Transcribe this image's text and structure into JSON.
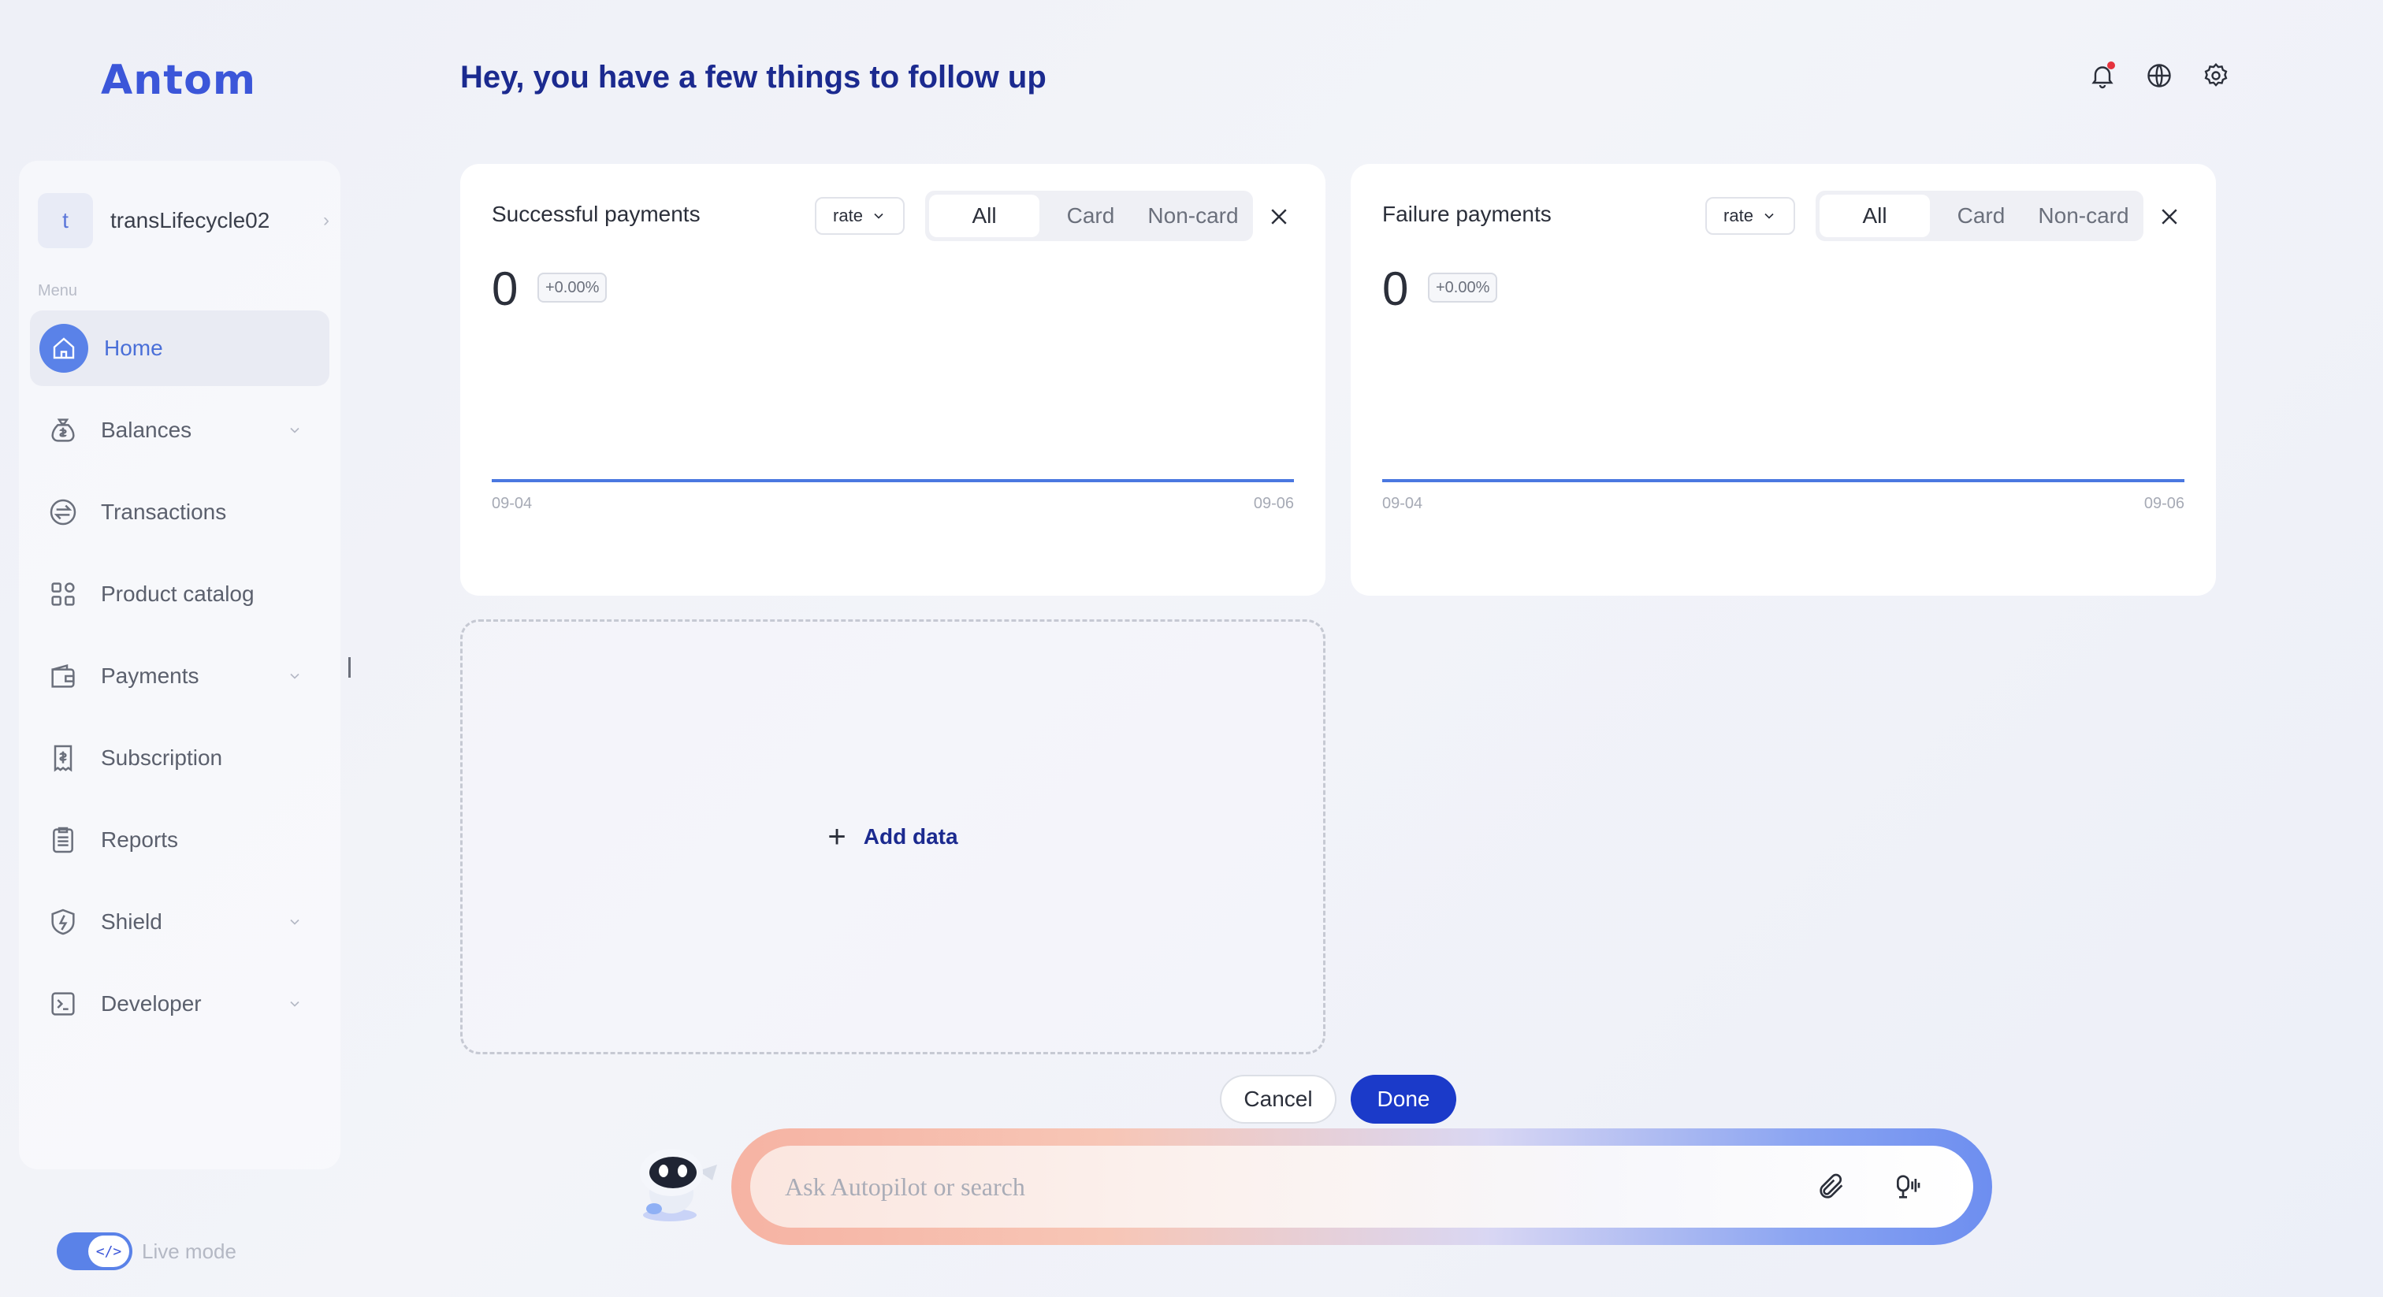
{
  "app": {
    "logo": "Antom"
  },
  "header": {
    "title": "Hey, you have a few things to follow up"
  },
  "account": {
    "initial": "t",
    "name": "transLifecycle02"
  },
  "sidebar": {
    "menu_label": "Menu",
    "items": [
      {
        "label": "Home"
      },
      {
        "label": "Balances"
      },
      {
        "label": "Transactions"
      },
      {
        "label": "Product catalog"
      },
      {
        "label": "Payments"
      },
      {
        "label": "Subscription"
      },
      {
        "label": "Reports"
      },
      {
        "label": "Shield"
      },
      {
        "label": "Developer"
      }
    ]
  },
  "live_mode": {
    "label": "Live mode",
    "toggle_glyph": "</>"
  },
  "cards": [
    {
      "title": "Successful payments",
      "metric_select": "rate",
      "tabs": [
        "All",
        "Card",
        "Non-card"
      ],
      "selected_tab": "All",
      "value": "0",
      "change": "+0.00%",
      "x_start": "09-04",
      "x_end": "09-06"
    },
    {
      "title": "Failure payments",
      "metric_select": "rate",
      "tabs": [
        "All",
        "Card",
        "Non-card"
      ],
      "selected_tab": "All",
      "value": "0",
      "change": "+0.00%",
      "x_start": "09-04",
      "x_end": "09-06"
    }
  ],
  "add_data": {
    "label": "Add data"
  },
  "actions": {
    "cancel": "Cancel",
    "done": "Done"
  },
  "search": {
    "placeholder": "Ask Autopilot or search"
  },
  "colors": {
    "accent": "#3b56d9",
    "title": "#1b2a8f",
    "done_button": "#1b3ac9",
    "chart_line": "#4a78e0",
    "notification": "#e5323d"
  }
}
